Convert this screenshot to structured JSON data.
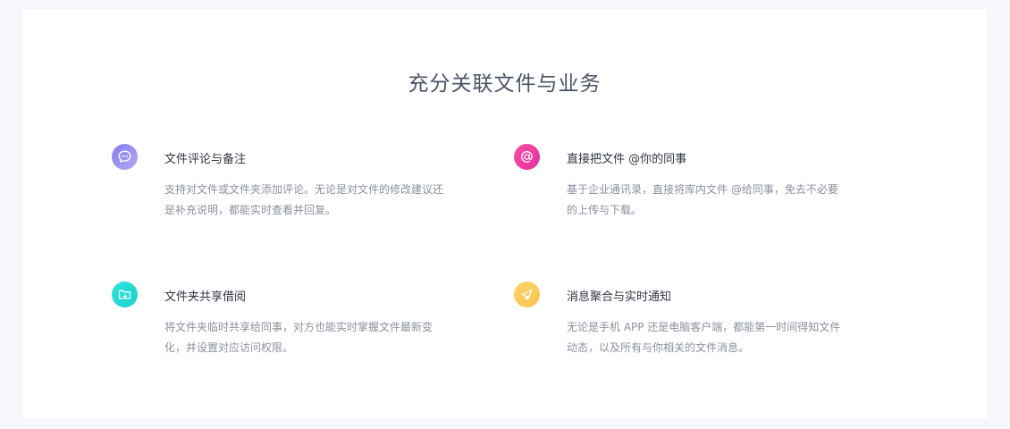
{
  "section": {
    "title": "充分关联文件与业务"
  },
  "features": [
    {
      "icon": "comment-bubble-icon",
      "title": "文件评论与备注",
      "desc_line1": "支持对文件或文件夹添加评论。无论是对文件的修改建议还",
      "desc_line2": "是补充说明，都能实时查看并回复。"
    },
    {
      "icon": "at-sign-icon",
      "title": "直接把文件 @你的同事",
      "desc_line1": "基于企业通讯录，直接将库内文件 @给同事，免去不必要",
      "desc_line2": "的上传与下载。"
    },
    {
      "icon": "shared-folder-icon",
      "title": "文件夹共享借阅",
      "desc_line1": "将文件夹临时共享给同事，对方也能实时掌握文件最新变",
      "desc_line2": "化，并设置对应访问权限。"
    },
    {
      "icon": "paper-plane-icon",
      "title": "消息聚合与实时通知",
      "desc_line1": "无论是手机 APP 还是电脑客户端，都能第一时间得知文件",
      "desc_line2": "动态，以及所有与你相关的文件消息。"
    }
  ],
  "colors": {
    "page_bg": "#f5f7fc",
    "card_bg": "#ffffff",
    "title": "#4b5366",
    "feature_title": "#2f3542",
    "feature_desc": "#8a909c",
    "icon_comment": "#8f89f1",
    "icon_at": "#f23fa3",
    "icon_folder": "#22dcd5",
    "icon_plane": "#fbcb5b"
  }
}
